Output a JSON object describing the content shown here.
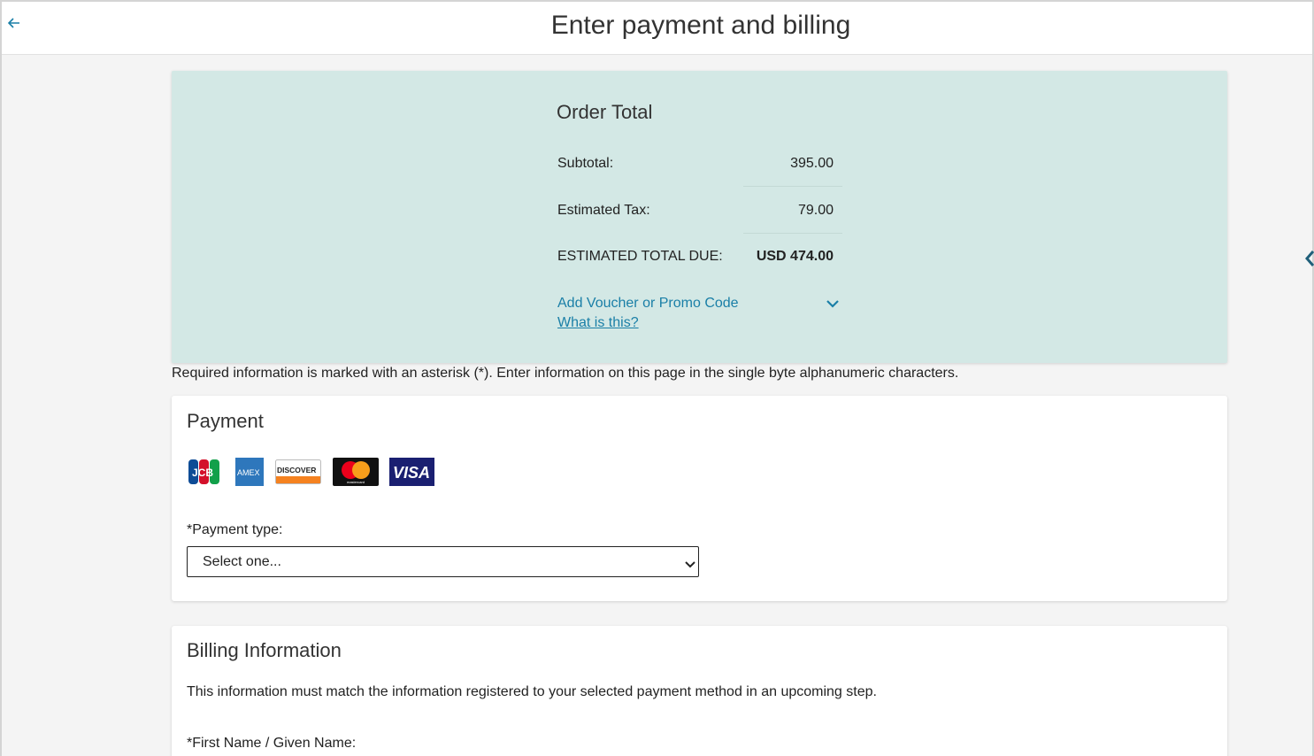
{
  "header": {
    "title": "Enter payment and billing"
  },
  "order": {
    "title": "Order Total",
    "subtotal_label": "Subtotal:",
    "subtotal_value": "395.00",
    "tax_label": "Estimated Tax:",
    "tax_value": "79.00",
    "total_label": "ESTIMATED TOTAL DUE:",
    "total_value": "USD 474.00",
    "promo_label": "Add Voucher or Promo Code",
    "what_is_this": "What is this?",
    "panel_color": "#d3e8e5",
    "link_color": "#1a7fa7"
  },
  "required_note": "Required information is marked with an asterisk (*). Enter information on this page in the single byte alphanumeric characters.",
  "payment": {
    "title": "Payment",
    "card_logos": [
      "JCB",
      "AMEX",
      "DISCOVER",
      "mastercard",
      "VISA"
    ],
    "type_label": "*Payment type:",
    "type_value": "Select one..."
  },
  "billing": {
    "title": "Billing Information",
    "description": "This information must match the information registered to your selected payment method in an upcoming step.",
    "first_name_label": "*First Name / Given Name:"
  }
}
